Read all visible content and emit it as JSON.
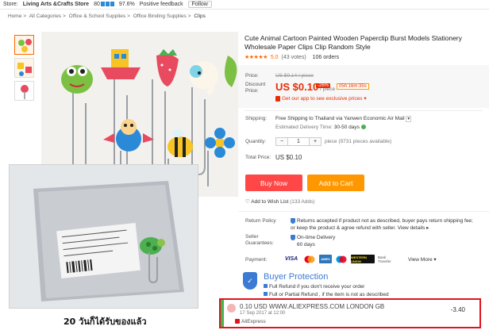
{
  "store": {
    "label": "Store:",
    "name": "Living Arts &Crafts Store",
    "score": "80",
    "feedback_pct": "97.6%",
    "feedback_label": "Positive feedback",
    "follow_label": "Follow"
  },
  "breadcrumb": [
    "Home",
    "All Categories",
    "Office & School Supplies",
    "Office Binding Supplies",
    "Clips"
  ],
  "product": {
    "title": "Cute Animal Cartoon Painted Wooden Paperclip Burst Models Stationery Wholesale Paper Clips Clip Random Style",
    "stars": "★★★★★",
    "score": "5.0",
    "votes": "(43 votes)",
    "orders": "106 orders"
  },
  "price": {
    "price_label": "Price:",
    "old_price": "US $0.14 / piece",
    "discount_label": "Discount Price:",
    "new_price": "US $0.10",
    "per": "/ piece",
    "discount": "-26%",
    "countdown": "05h:16m:35s",
    "app_promo": "Get our app to see exclusive prices"
  },
  "shipping": {
    "label": "Shipping:",
    "value": "Free Shipping to Thailand via Yanwen Economic Air Mail",
    "est_label": "Estimated Delivery Time:",
    "est_value": "30-50 days"
  },
  "quantity": {
    "label": "Quantity:",
    "value": "1",
    "minus": "−",
    "plus": "+",
    "info": "piece (9731 pieces available)"
  },
  "total": {
    "label": "Total Price:",
    "value": "US $0.10"
  },
  "actions": {
    "buy": "Buy Now",
    "cart": "Add to Cart",
    "wish": "Add to Wish List",
    "wish_count": "(133 Adds)"
  },
  "returns": {
    "label": "Return Policy",
    "text": "Returns accepted if product not as described, buyer pays return shipping fee; or keep the product & agree refund with seller.",
    "link": "View details"
  },
  "guarantee": {
    "label": "Seller Guarantees:",
    "line1": "On-time Delivery",
    "line2": "60 days"
  },
  "payment": {
    "label": "Payment:",
    "methods": [
      "VISA",
      "MC",
      "AMEX",
      "WU",
      "Bank Transfer"
    ],
    "more": "View More"
  },
  "buyer_protection": {
    "title": "Buyer Protection",
    "line1": "Full Refund if you don't receive your order",
    "line2": "Full or Partial Refund , if the item is not as described"
  },
  "notification": {
    "line1": "0.10 USD WWW.ALIEXPRESS.COM LONDON GB",
    "date": "17 Sep 2017 at 12:00",
    "amount": "-3.40",
    "brand": "AliExpress"
  },
  "caption": "20 วันก็ได้รับของแล้ว",
  "colors": {
    "accent": "#e62e04",
    "buy": "#ff4747",
    "cart": "#ff9800",
    "protection": "#3b7bd4",
    "highlight": "#e0141e"
  }
}
